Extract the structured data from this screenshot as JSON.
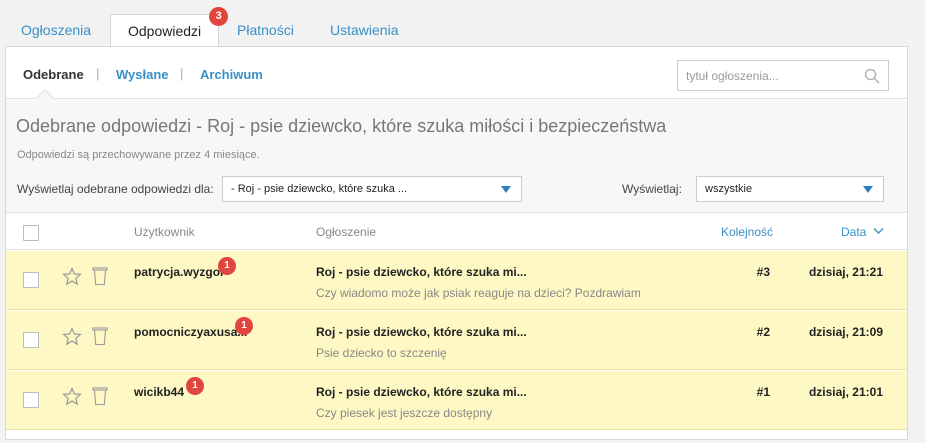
{
  "tabs": [
    {
      "label": "Ogłoszenia"
    },
    {
      "label": "Odpowiedzi",
      "badge": "3"
    },
    {
      "label": "Płatności"
    },
    {
      "label": "Ustawienia"
    }
  ],
  "subnav": {
    "items": [
      {
        "label": "Odebrane"
      },
      {
        "label": "Wysłane"
      },
      {
        "label": "Archiwum"
      }
    ],
    "separator": "|"
  },
  "search": {
    "placeholder": "tytuł ogłoszenia...",
    "value": ""
  },
  "header": {
    "title": "Odebrane odpowiedzi - Roj - psie dziewcko, które szuka miłości i bezpieczeństwa",
    "subtitle": "Odpowiedzi są przechowywane przez 4 miesiące.",
    "filter_label": "Wyświetlaj odebrane odpowiedzi dla:",
    "filter_value": "- Roj - psie dziewcko, które szuka ...",
    "display_label": "Wyświetlaj:",
    "display_value": "wszystkie"
  },
  "table": {
    "columns": {
      "user": "Użytkownik",
      "ad": "Ogłoszenie",
      "order": "Kolejność",
      "date": "Data"
    },
    "rows": [
      {
        "user": "patrycja.wyzgol",
        "badge": "1",
        "ad_title": "Roj - psie dziewcko, które szuka mi...",
        "message": "Czy wiadomo może jak psiak reaguje na dzieci? Pozdrawiam",
        "order": "#3",
        "date": "dzisiaj, 21:21"
      },
      {
        "user": "pomocniczyaxusa...",
        "badge": "1",
        "ad_title": "Roj - psie dziewcko, które szuka mi...",
        "message": "Psie dziecko to szczenię",
        "order": "#2",
        "date": "dzisiaj, 21:09"
      },
      {
        "user": "wicikb44",
        "badge": "1",
        "ad_title": "Roj - psie dziewcko, które szuka mi...",
        "message": "Czy piesek jest jeszcze dostępny",
        "order": "#1",
        "date": "dzisiaj, 21:01"
      }
    ]
  },
  "colors": {
    "link": "#3a8fc7",
    "badge": "#e2453c",
    "row_highlight": "#fdf8c4"
  }
}
